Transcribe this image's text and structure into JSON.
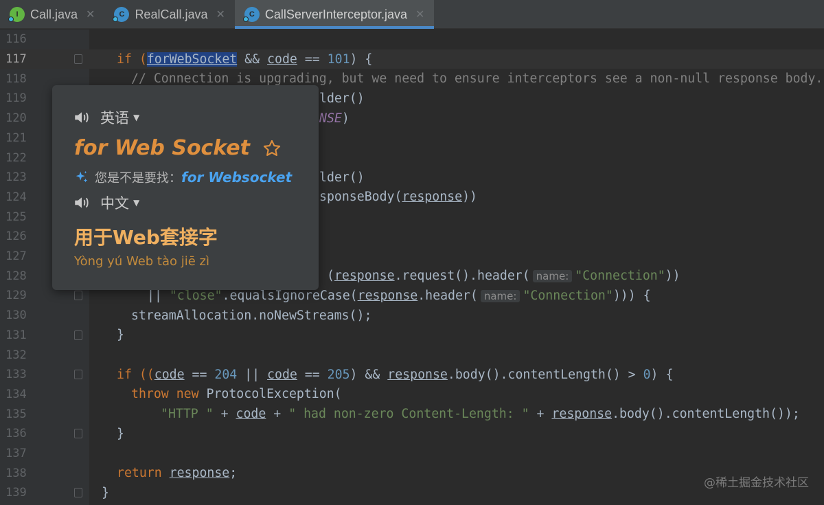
{
  "tabs": [
    {
      "label": "Call.java",
      "icon": "interface-icon",
      "active": false
    },
    {
      "label": "RealCall.java",
      "icon": "class-icon",
      "active": false
    },
    {
      "label": "CallServerInterceptor.java",
      "icon": "class-icon",
      "active": true
    }
  ],
  "tab_close_glyph": "✕",
  "editor": {
    "line_numbers": [
      "116",
      "117",
      "118",
      "119",
      "120",
      "121",
      "122",
      "123",
      "124",
      "125",
      "126",
      "127",
      "128",
      "129",
      "130",
      "131",
      "132",
      "133",
      "134",
      "135",
      "136",
      "137",
      "138",
      "139"
    ],
    "current_line": "117",
    "fragments": {
      "l117_if": "if (",
      "l117_sel_a": "for",
      "l117_sel_b": "WebSocket",
      "l117_and": " && ",
      "l117_code": "code",
      "l117_eq": " == ",
      "l117_num": "101",
      "l117_end": ") {",
      "l118": "// Connection is upgrading, but we need to ensure interceptors see a non-null response body.",
      "l119": "lder()",
      "l120": "NSE",
      "l120_end": ")",
      "l123": "lder()",
      "l124_a": "sponseBody(",
      "l124_b": "response",
      "l124_c": "))",
      "l128_a": "(",
      "l128_b": "response",
      "l128_c": ".request().",
      "l128_d": "header",
      "l128_e": "(",
      "l128_hint": "name:",
      "l128_f": "\"Connection\"",
      "l128_g": "))",
      "l129_a": "|| ",
      "l129_b": "\"close\"",
      "l129_c": ".equalsIgnoreCase(",
      "l129_d": "response",
      "l129_e": ".header(",
      "l129_hint": "name:",
      "l129_f": "\"Connection\"",
      "l129_g": "))) {",
      "l130": "streamAllocation.noNewStreams();",
      "l131": "}",
      "l133_if": "if ((",
      "l133_code1": "code",
      "l133_eq1": " == ",
      "l133_204": "204",
      "l133_or": " || ",
      "l133_code2": "code",
      "l133_eq2": " == ",
      "l133_205": "205",
      "l133_mid": ") && ",
      "l133_resp": "response",
      "l133_tail": ".body().contentLength() > ",
      "l133_zero": "0",
      "l133_end": ") {",
      "l134_kw": "throw new",
      "l134_rest": " ProtocolException(",
      "l135_s1": "\"HTTP \"",
      "l135_p1": " + ",
      "l135_code": "code",
      "l135_p2": " + ",
      "l135_s2": "\" had non-zero Content-Length: \"",
      "l135_p3": " + ",
      "l135_resp": "response",
      "l135_tail": ".body().contentLength());",
      "l136": "}",
      "l138_kw": "return",
      "l138_resp": "response",
      "l138_end": ";",
      "l139": "}"
    }
  },
  "popup": {
    "source_lang": "英语",
    "word": "for Web Socket",
    "suggest_prefix": "您是不是要找：",
    "suggest_link": "for Websocket",
    "target_lang": "中文",
    "translation": "用于Web套接字",
    "pinyin": "Yòng yú Web tào jiē zì"
  },
  "watermark": "@稀土掘金技术社区",
  "colors": {
    "background": "#2b2b2b",
    "keyword": "#cc7832",
    "number": "#6897bb",
    "string": "#6a8759",
    "comment": "#808080",
    "popup_word": "#e0903e",
    "popup_link": "#4aa3f0",
    "tab_active_underline": "#4a88c7"
  }
}
